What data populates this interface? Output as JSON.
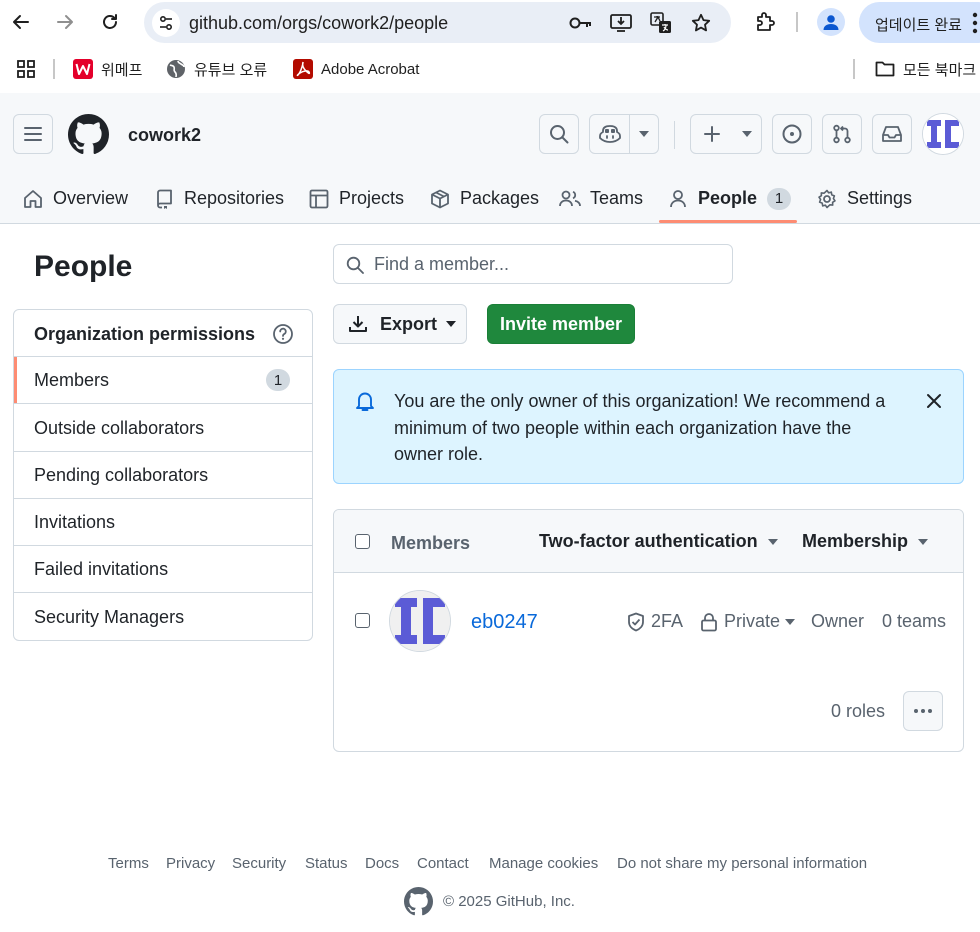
{
  "browser": {
    "url": "github.com/orgs/cowork2/people",
    "update_label": "업데이트 완료"
  },
  "bookmarks": {
    "items": [
      "위메프",
      "유튜브 오류",
      "Adobe Acrobat"
    ],
    "folder": "모든 북마크"
  },
  "header": {
    "org_name": "cowork2"
  },
  "tabs": [
    {
      "label": "Overview"
    },
    {
      "label": "Repositories"
    },
    {
      "label": "Projects"
    },
    {
      "label": "Packages"
    },
    {
      "label": "Teams"
    },
    {
      "label": "People",
      "count": "1"
    },
    {
      "label": "Settings"
    }
  ],
  "sidebar": {
    "title": "People",
    "section": "Organization permissions",
    "items": [
      {
        "label": "Members",
        "count": "1"
      },
      {
        "label": "Outside collaborators"
      },
      {
        "label": "Pending collaborators"
      },
      {
        "label": "Invitations"
      },
      {
        "label": "Failed invitations"
      },
      {
        "label": "Security Managers"
      }
    ]
  },
  "search": {
    "placeholder": "Find a member..."
  },
  "actions": {
    "export_label": "Export",
    "invite_label": "Invite member"
  },
  "flash": {
    "message": "You are the only owner of this organization! We recommend a minimum of two people within each organization have the owner role."
  },
  "members_table": {
    "header_members": "Members",
    "filter_2fa": "Two-factor authentication",
    "filter_membership": "Membership",
    "rows": [
      {
        "login": "eb0247",
        "twofa": "2FA",
        "visibility": "Private",
        "role": "Owner",
        "teams": "0 teams",
        "roles": "0 roles"
      }
    ]
  },
  "footer": {
    "links": [
      "Terms",
      "Privacy",
      "Security",
      "Status",
      "Docs",
      "Contact",
      "Manage cookies",
      "Do not share my personal information"
    ],
    "copyright": "© 2025 GitHub, Inc."
  },
  "colors": {
    "accent_orange": "#fd8c73",
    "primary_green": "#1f883d",
    "link_blue": "#0969da",
    "flash_bg": "#ddf4ff",
    "avatar_purple": "#5b5bd6"
  }
}
